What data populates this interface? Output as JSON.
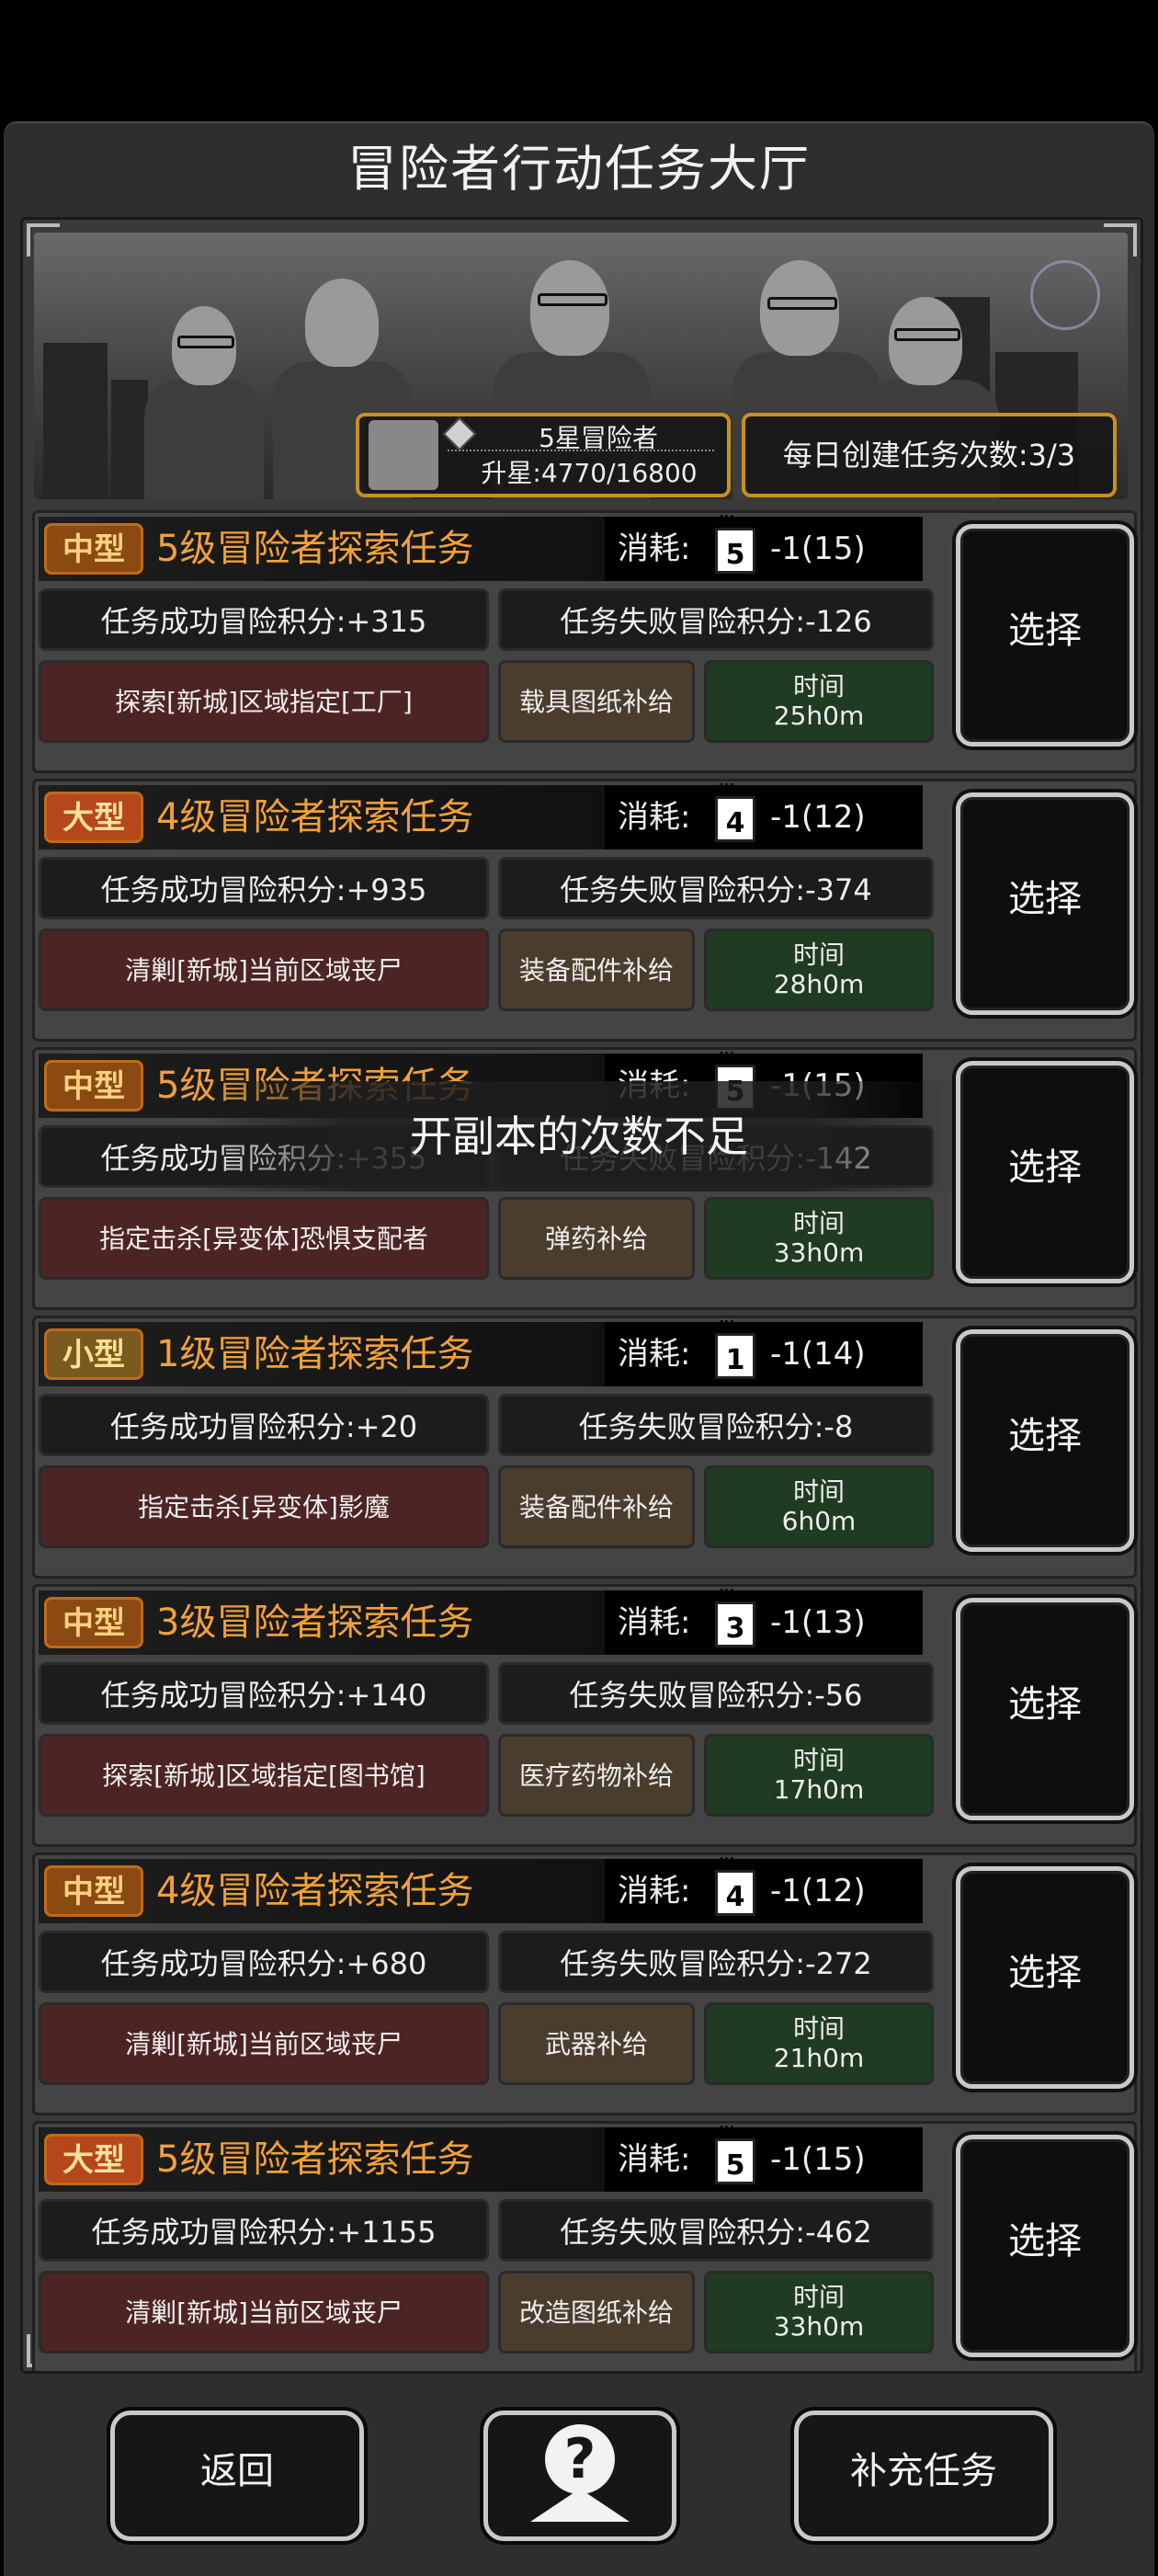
{
  "title": "冒险者行动任务大厅",
  "header": {
    "rank_name": "5星冒险者",
    "rank_progress": "升星:4770/16800",
    "daily_create": "每日创建任务次数:3/3"
  },
  "toast": "开副本的次数不足",
  "cost_label": "消耗:",
  "select_label": "选择",
  "time_label": "时间",
  "tasks": [
    {
      "size": "中型",
      "size_kind": "med",
      "name": "5级冒险者探索任务",
      "level": "5",
      "cost": "-1(15)",
      "success": "任务成功冒险积分:+315",
      "fail": "任务失败冒险积分:-126",
      "target": "探索[新城]区域指定[工厂]",
      "supply": "载具图纸补给",
      "time": "25h0m"
    },
    {
      "size": "大型",
      "size_kind": "big",
      "name": "4级冒险者探索任务",
      "level": "4",
      "cost": "-1(12)",
      "success": "任务成功冒险积分:+935",
      "fail": "任务失败冒险积分:-374",
      "target": "清剿[新城]当前区域丧尸",
      "supply": "装备配件补给",
      "time": "28h0m"
    },
    {
      "size": "中型",
      "size_kind": "med",
      "name": "5级冒险者探索任务",
      "level": "5",
      "cost": "-1(15)",
      "success": "任务成功冒险积分:+355",
      "fail": "任务失败冒险积分:-142",
      "target": "指定击杀[异变体]恐惧支配者",
      "supply": "弹药补给",
      "time": "33h0m"
    },
    {
      "size": "小型",
      "size_kind": "small",
      "name": "1级冒险者探索任务",
      "level": "1",
      "cost": "-1(14)",
      "success": "任务成功冒险积分:+20",
      "fail": "任务失败冒险积分:-8",
      "target": "指定击杀[异变体]影魔",
      "supply": "装备配件补给",
      "time": "6h0m"
    },
    {
      "size": "中型",
      "size_kind": "med",
      "name": "3级冒险者探索任务",
      "level": "3",
      "cost": "-1(13)",
      "success": "任务成功冒险积分:+140",
      "fail": "任务失败冒险积分:-56",
      "target": "探索[新城]区域指定[图书馆]",
      "supply": "医疗药物补给",
      "time": "17h0m"
    },
    {
      "size": "中型",
      "size_kind": "med",
      "name": "4级冒险者探索任务",
      "level": "4",
      "cost": "-1(12)",
      "success": "任务成功冒险积分:+680",
      "fail": "任务失败冒险积分:-272",
      "target": "清剿[新城]当前区域丧尸",
      "supply": "武器补给",
      "time": "21h0m"
    },
    {
      "size": "大型",
      "size_kind": "big",
      "name": "5级冒险者探索任务",
      "level": "5",
      "cost": "-1(15)",
      "success": "任务成功冒险积分:+1155",
      "fail": "任务失败冒险积分:-462",
      "target": "清剿[新城]当前区域丧尸",
      "supply": "改造图纸补给",
      "time": "33h0m"
    }
  ],
  "footer": {
    "back": "返回",
    "help_glyph": "?",
    "refill": "补充任务"
  }
}
